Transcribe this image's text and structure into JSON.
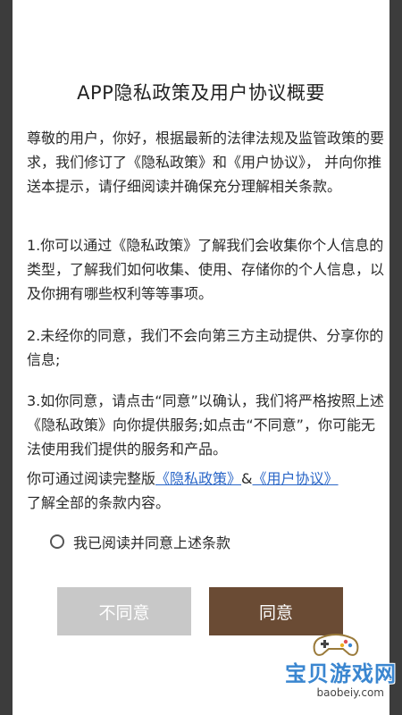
{
  "dialog": {
    "title": "APP隐私政策及用户协议概要",
    "para1": "尊敬的用户，你好，根据最新的法律法规及监管政策的要求，我们修订了《隐私政策》和《用户协议》， 并向你推送本提示，请仔细阅读并确保充分理解相关条款。",
    "para2": "1.你可以通过《隐私政策》了解我们会收集你个人信息的类型，了解我们如何收集、使用、存储你的个人信息，以及你拥有哪些权利等等事项。",
    "para3": "2.未经你的同意，我们不会向第三方主动提供、分享你的信息;",
    "para4": "3.如你同意，请点击“同意”以确认，我们将严格按照上述《隐私政策》向你提供服务;如点击“不同意”，你可能无法使用我们提供的服务和产品。",
    "para5_prefix": "你可通过阅读完整版",
    "privacy_link": "《隐私政策》",
    "para5_amp": "&",
    "user_link": "《用户协议》",
    "para5_suffix": "了解全部的条款内容。",
    "agree_checkbox_label": "我已阅读并同意上述条款",
    "disagree_button": "不同意",
    "agree_button": "同意"
  },
  "watermark": {
    "text": "宝贝游戏网",
    "url": "baobeiy.com",
    "icon": "gamepad-icon"
  },
  "colors": {
    "backdrop": "#3c3c3c",
    "link": "#2a66c7",
    "agree_button": "#6a4b34",
    "disagree_button": "#c8c8c8"
  }
}
